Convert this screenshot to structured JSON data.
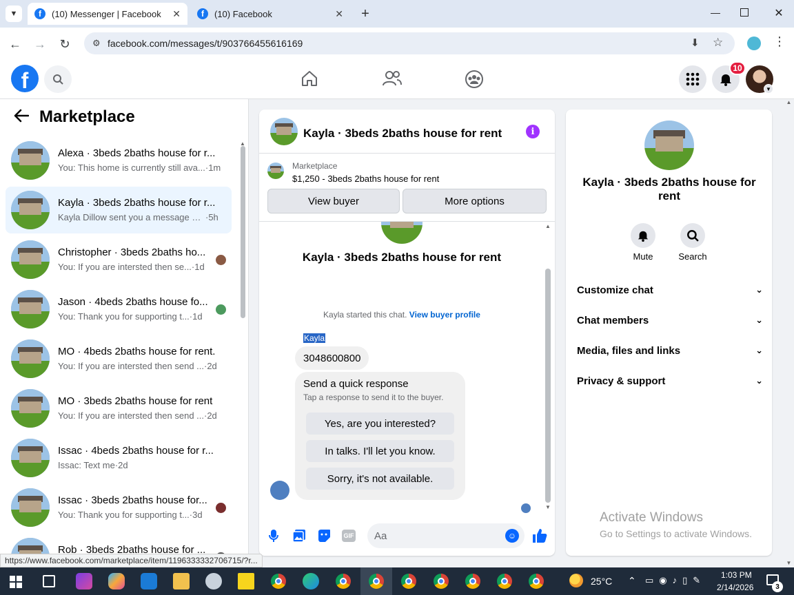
{
  "browser": {
    "tabs": [
      {
        "title": "(10) Messenger | Facebook",
        "active": true
      },
      {
        "title": "(10) Facebook",
        "active": false
      }
    ],
    "url": "facebook.com/messages/t/903766455616169",
    "status_url": "https://www.facebook.com/marketplace/item/1196333332706715/?r..."
  },
  "header": {
    "logo_letter": "f",
    "notification_count": "10"
  },
  "left": {
    "title": "Marketplace",
    "conversations": [
      {
        "title": "Alexa · 3beds 2baths house for r...",
        "preview": "You: This home is currently still ava...",
        "time": "·1m",
        "active": false
      },
      {
        "title": "Kayla · 3beds 2baths house for r...",
        "preview": "Kayla Dillow sent you a message ab...",
        "time": "·5h",
        "active": true
      },
      {
        "title": "Christopher · 3beds 2baths ho...",
        "preview": "You: If you are intersted then se...",
        "time": "·1d",
        "active": false
      },
      {
        "title": "Jason · 4beds 2baths house fo...",
        "preview": "You: Thank you for supporting t...",
        "time": "·1d",
        "active": false
      },
      {
        "title": "MO · 4beds 2baths house for rent.",
        "preview": "You: If you are intersted then send ...",
        "time": "·2d",
        "active": false
      },
      {
        "title": "MO · 3beds 2baths house for rent",
        "preview": "You: If you are intersted then send ...",
        "time": "·2d",
        "active": false
      },
      {
        "title": "Issac · 4beds 2baths house for r...",
        "preview": "Issac: Text me",
        "time": "·2d",
        "active": false
      },
      {
        "title": "Issac · 3beds 2baths house for...",
        "preview": "You: Thank you for supporting t...",
        "time": "·3d",
        "active": false
      },
      {
        "title": "Rob · 3beds 2baths house for ...",
        "preview": "",
        "time": "",
        "active": false
      }
    ]
  },
  "chat": {
    "title": "Kayla · 3beds 2baths house for rent",
    "listing_label": "Marketplace",
    "listing_desc": "$1,250 - 3beds 2baths house for rent",
    "view_buyer": "View buyer",
    "more_options": "More options",
    "intro_title": "Kayla · 3beds 2baths house for rent",
    "started_text": "Kayla started this chat.",
    "view_profile": "View buyer profile",
    "sender_name": "Kayla",
    "message": "3048600800",
    "quick_title": "Send a quick response",
    "quick_sub": "Tap a response to send it to the buyer.",
    "quick_replies": [
      "Yes, are you interested?",
      "In talks. I'll let you know.",
      "Sorry, it's not available."
    ],
    "composer_placeholder": "Aa"
  },
  "info": {
    "name": "Kayla · 3beds 2baths house for rent",
    "mute": "Mute",
    "search": "Search",
    "rows": [
      "Customize chat",
      "Chat members",
      "Media, files and links",
      "Privacy & support"
    ]
  },
  "watermark": {
    "title": "Activate Windows",
    "sub": "Go to Settings to activate Windows."
  },
  "taskbar": {
    "weather": "25°C",
    "time": "1:03 PM",
    "date": "2/14/2026",
    "notif": "3"
  },
  "colors": {
    "fb_blue": "#1877f2",
    "link_blue": "#0064d1",
    "info_purple": "#a033ff",
    "badge_red": "#e41e3f"
  }
}
